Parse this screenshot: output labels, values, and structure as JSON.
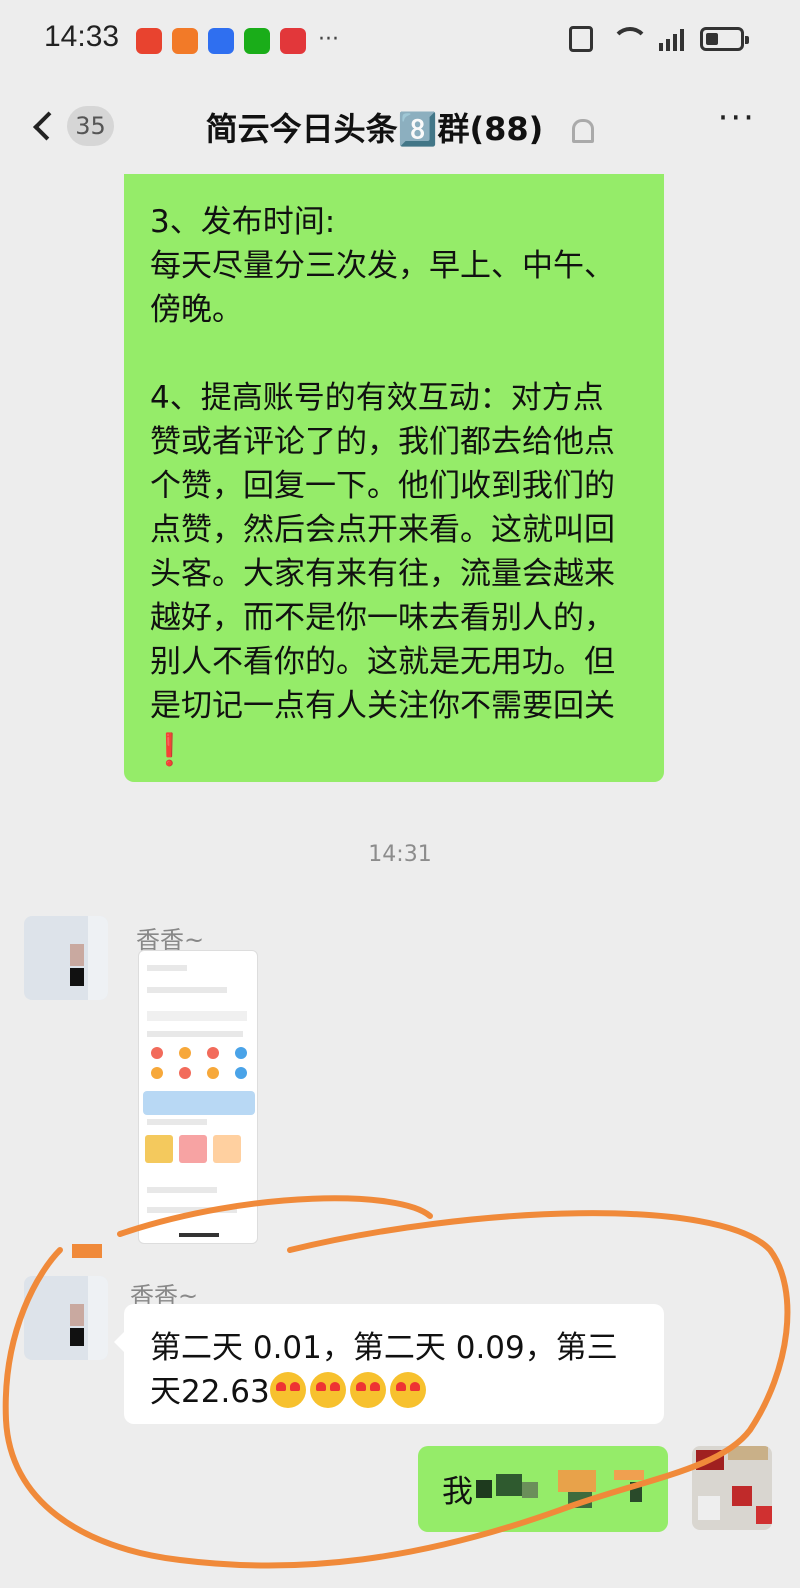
{
  "status_bar": {
    "time": "14:33",
    "notification_icons": [
      "news-app-icon",
      "taobao-icon",
      "browser-icon",
      "wechat-icon",
      "mail-icon"
    ],
    "more_indicator": "···"
  },
  "nav": {
    "badge": "35",
    "title": "简云今日头条8️⃣群(88)",
    "more": "···"
  },
  "messages": {
    "green_bubble": {
      "lines": [
        "3、发布时间:",
        "每天尽量分三次发，早上、中午、",
        "傍晚。",
        "",
        "4、提高账号的有效互动：对方点",
        "赞或者评论了的，我们都去给他点",
        "个赞，回复一下。他们收到我们的",
        "点赞，然后会点开来看。这就叫回",
        "头客。大家有来有往，流量会越来",
        "越好，而不是你一味去看别人的，",
        "别人不看你的。这就是无用功。但",
        "是切记一点有人关注你不需要回关"
      ],
      "exclamation": "❗"
    },
    "timestamp": "14:31",
    "image_message": {
      "sender": "香香~"
    },
    "text_message": {
      "sender": "香香~",
      "line1": "第二天 0.01，第二天 0.09，第三",
      "line2": "天22.63"
    },
    "my_message": {
      "text": "我"
    }
  },
  "colors": {
    "background": "#ededed",
    "green_bubble": "#95ec69",
    "white_bubble": "#ffffff",
    "annotation": "#f08a3a"
  }
}
